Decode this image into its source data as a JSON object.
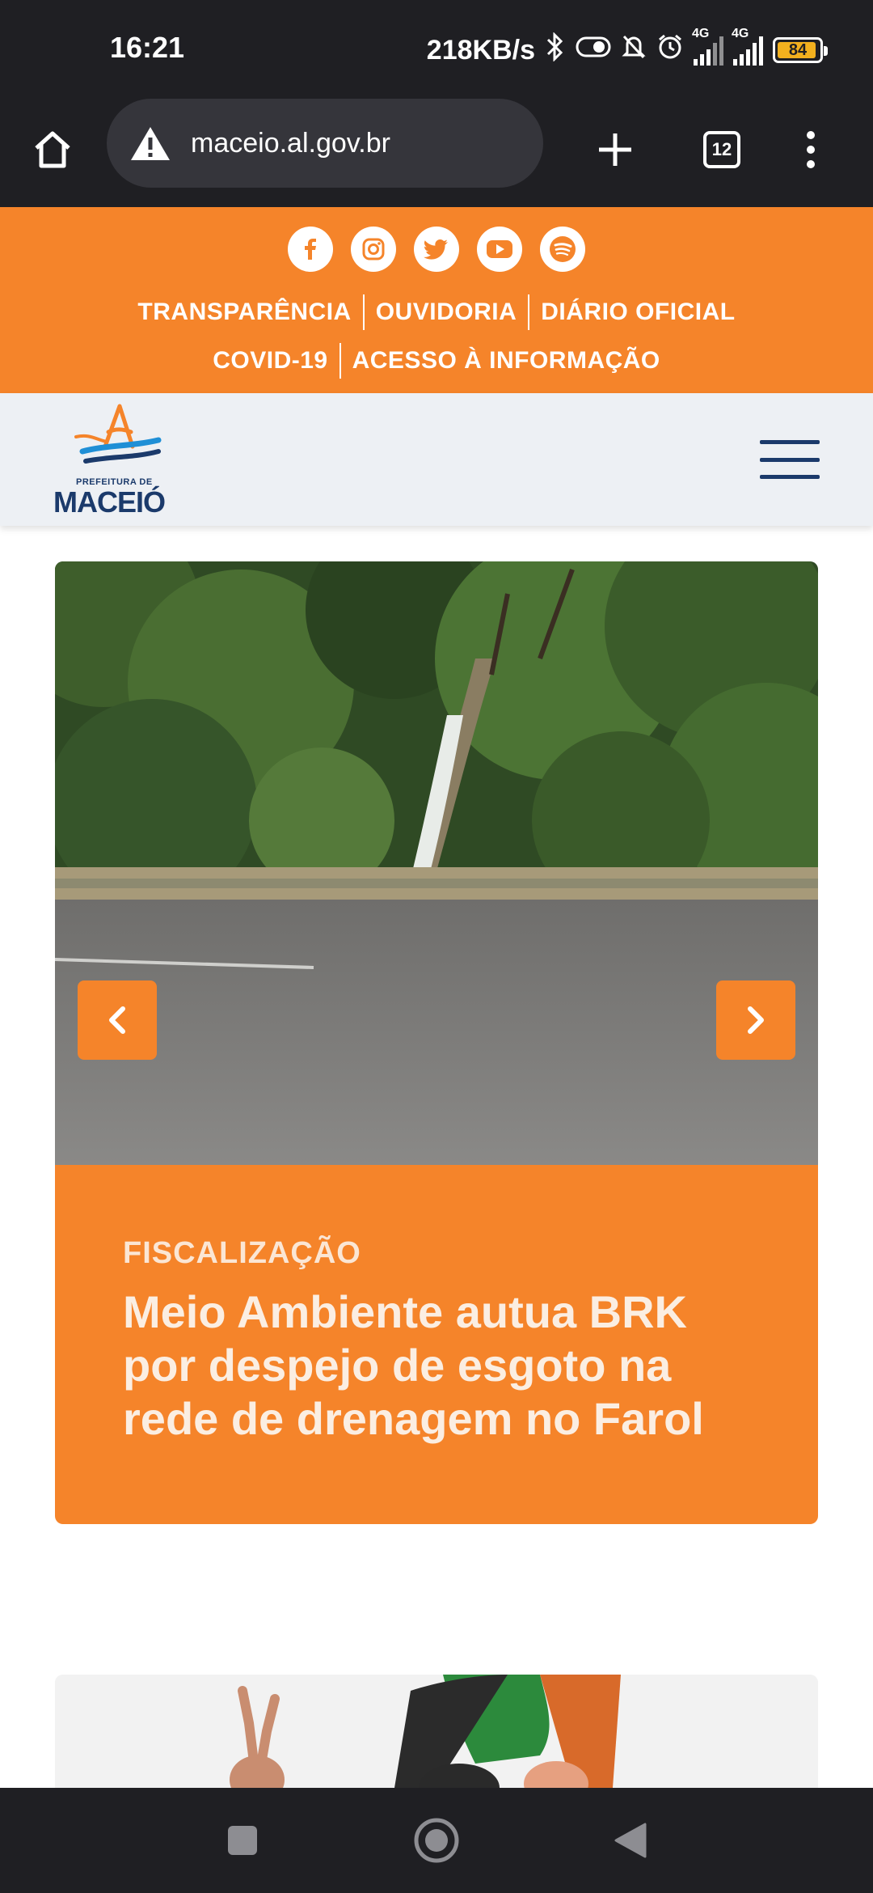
{
  "status_bar": {
    "time": "16:21",
    "speed": "218KB/s",
    "network_1": "4G",
    "network_2": "4G",
    "battery": "84",
    "battery_level_percent": 84
  },
  "browser": {
    "url": "maceio.al.gov.br",
    "tab_count": "12"
  },
  "top_bar": {
    "socials": [
      "facebook-icon",
      "instagram-icon",
      "twitter-icon",
      "youtube-icon",
      "spotify-icon"
    ],
    "links_row1": [
      "TRANSPARÊNCIA",
      "OUVIDORIA",
      "DIÁRIO OFICIAL"
    ],
    "links_row2": [
      "COVID-19",
      "ACESSO À INFORMAÇÃO"
    ]
  },
  "header": {
    "logo_small": "PREFEITURA DE",
    "logo_big": "MACEIÓ"
  },
  "carousel": {
    "category": "FISCALIZAÇÃO",
    "headline": "Meio Ambiente autua BRK por despejo de esgoto na rede de drenagem no Farol"
  },
  "colors": {
    "brand_orange": "#f5842a",
    "brand_navy": "#1b3a6b",
    "system_bar": "#1f1f23"
  }
}
